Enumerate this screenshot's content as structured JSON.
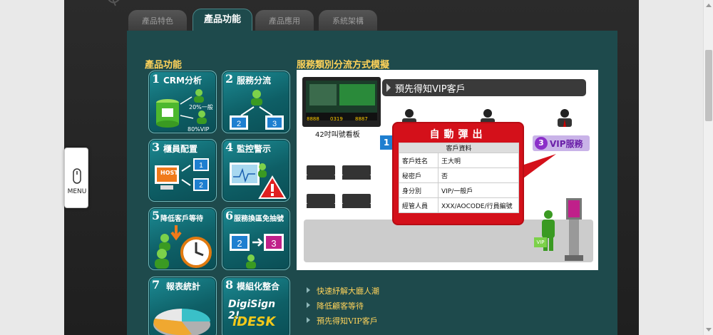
{
  "tabs": [
    "產品特色",
    "產品功能",
    "產品應用",
    "系統架構"
  ],
  "active_tab": "產品功能",
  "section_title": "產品功能",
  "demo_title": "服務類別分流方式模擬",
  "tiles": [
    {
      "num": "1",
      "label": "CRM分析",
      "notes": [
        "20%一般",
        "80%VIP"
      ]
    },
    {
      "num": "2",
      "label": "服務分流"
    },
    {
      "num": "3",
      "label": "櫃員配置",
      "notes": [
        "HOST"
      ]
    },
    {
      "num": "4",
      "label": "監控警示"
    },
    {
      "num": "5",
      "label": "降低客戶等待"
    },
    {
      "num": "6",
      "label": "服務換區免抽號"
    },
    {
      "num": "7",
      "label": "報表統計"
    },
    {
      "num": "8",
      "label": "模組化整合",
      "logos": [
        "DigiSign 2!",
        "iDESK"
      ]
    }
  ],
  "demo": {
    "banner": "預先得知VIP客戶",
    "board_label": "42吋叫號看板",
    "board_numbers": [
      "8888",
      "0319",
      "8887"
    ],
    "vip_badge_num": "3",
    "vip_badge_text": "VIP服務",
    "marker_num": "1",
    "vip_tag": "VIP",
    "popup_title": "自動彈出",
    "popup_header": "客戶資料",
    "popup_rows": [
      {
        "k": "客戶姓名",
        "v": "王大明"
      },
      {
        "k": "秘密戶",
        "v": "否"
      },
      {
        "k": "身分別",
        "v": "VIP/一般戶"
      },
      {
        "k": "經管人員",
        "v": "XXX/AOCODE/行員編號"
      }
    ]
  },
  "bullets": [
    "快速紓解大廳人潮",
    "降低顧客等待",
    "預先得知VIP客戶"
  ],
  "menu_label": "MENU",
  "colors": {
    "panel": "#1e4a4c",
    "accent": "#ffd35a",
    "popup": "#d4101a",
    "vip": "#8b2fc9"
  }
}
